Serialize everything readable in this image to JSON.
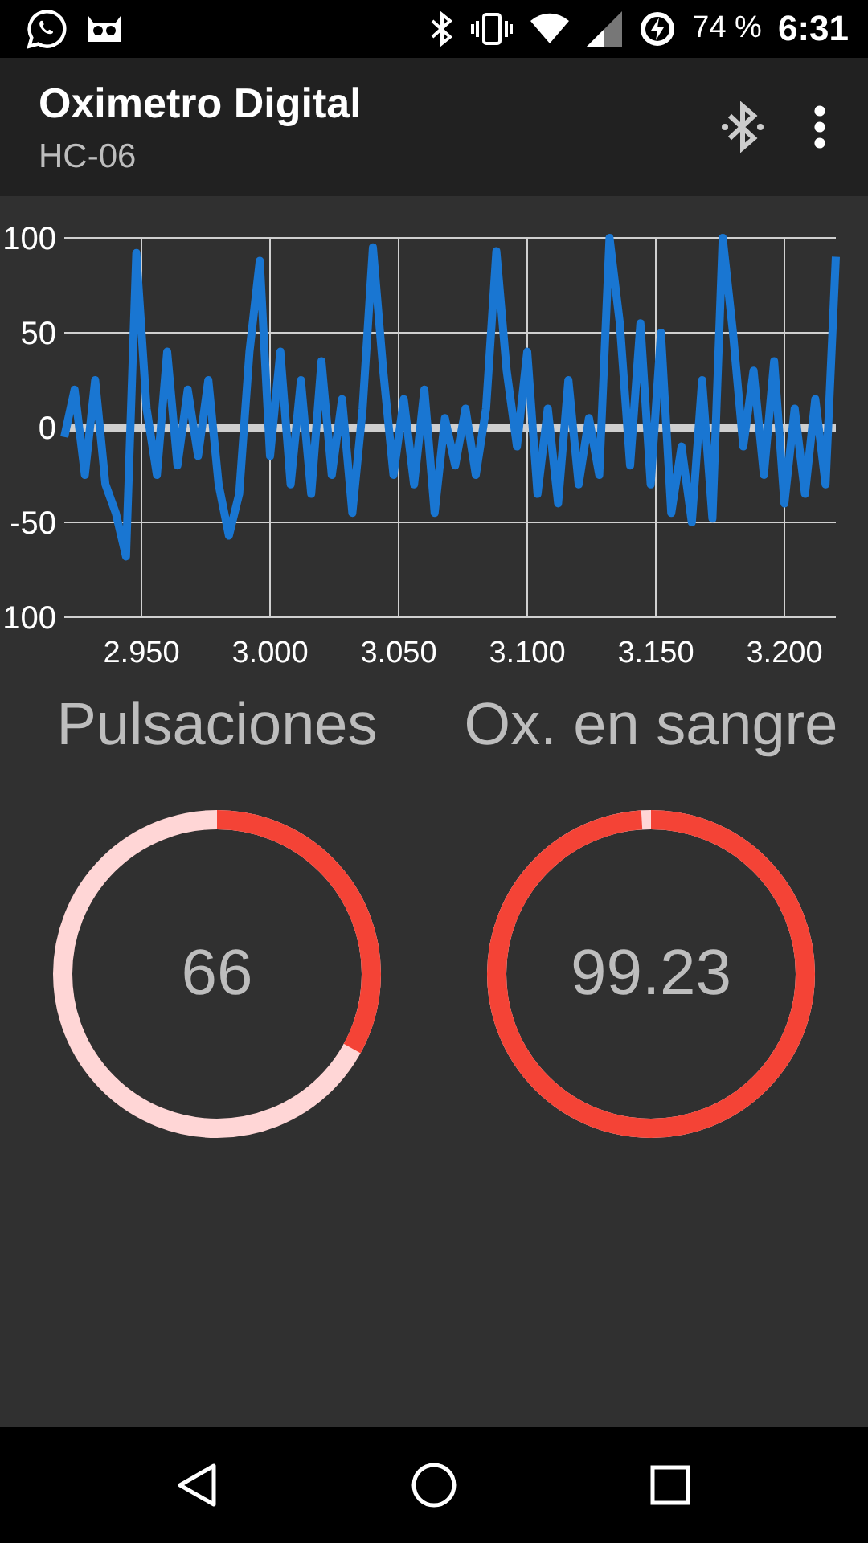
{
  "status_bar": {
    "battery": "74 %",
    "time": "6:31"
  },
  "app_bar": {
    "title": "Oximetro Digital",
    "subtitle": "HC-06"
  },
  "chart_data": {
    "type": "line",
    "xlim": [
      2.92,
      3.22
    ],
    "ylim": [
      -100,
      100
    ],
    "grid": true,
    "xticks": [
      {
        "value": 2.95,
        "label": "2.950"
      },
      {
        "value": 3.0,
        "label": "3.000"
      },
      {
        "value": 3.05,
        "label": "3.050"
      },
      {
        "value": 3.1,
        "label": "3.100"
      },
      {
        "value": 3.15,
        "label": "3.150"
      },
      {
        "value": 3.2,
        "label": "3.200"
      }
    ],
    "yticks": [
      100,
      50,
      0,
      -50,
      {
        "value": -100,
        "label": "100"
      }
    ],
    "x": [
      2.92,
      2.924,
      2.928,
      2.932,
      2.936,
      2.94,
      2.944,
      2.948,
      2.952,
      2.956,
      2.96,
      2.964,
      2.968,
      2.972,
      2.976,
      2.98,
      2.984,
      2.988,
      2.992,
      2.996,
      3.0,
      3.004,
      3.008,
      3.012,
      3.016,
      3.02,
      3.024,
      3.028,
      3.032,
      3.036,
      3.04,
      3.044,
      3.048,
      3.052,
      3.056,
      3.06,
      3.064,
      3.068,
      3.072,
      3.076,
      3.08,
      3.084,
      3.088,
      3.092,
      3.096,
      3.1,
      3.104,
      3.108,
      3.112,
      3.116,
      3.12,
      3.124,
      3.128,
      3.132,
      3.136,
      3.14,
      3.144,
      3.148,
      3.152,
      3.156,
      3.16,
      3.164,
      3.168,
      3.172,
      3.176,
      3.18,
      3.184,
      3.188,
      3.192,
      3.196,
      3.2,
      3.204,
      3.208,
      3.212,
      3.216,
      3.22
    ],
    "series": [
      {
        "color": "#1976d2",
        "values": [
          -5,
          20,
          -25,
          25,
          -30,
          -45,
          -68,
          92,
          10,
          -25,
          40,
          -20,
          20,
          -15,
          25,
          -30,
          -57,
          -35,
          40,
          88,
          -15,
          40,
          -30,
          25,
          -35,
          35,
          -25,
          15,
          -45,
          10,
          95,
          30,
          -25,
          15,
          -30,
          20,
          -45,
          5,
          -20,
          10,
          -25,
          10,
          93,
          30,
          -10,
          40,
          -35,
          10,
          -40,
          25,
          -30,
          5,
          -25,
          100,
          55,
          -20,
          55,
          -30,
          50,
          -45,
          -10,
          -50,
          25,
          -48,
          100,
          50,
          -10,
          30,
          -25,
          35,
          -40,
          10,
          -35,
          15,
          -30,
          90
        ]
      }
    ]
  },
  "gauges": [
    {
      "label": "Pulsaciones",
      "value": "66",
      "level": 0.33
    },
    {
      "label": "Ox. en sangre",
      "value": "99.23",
      "level": 0.99
    }
  ]
}
